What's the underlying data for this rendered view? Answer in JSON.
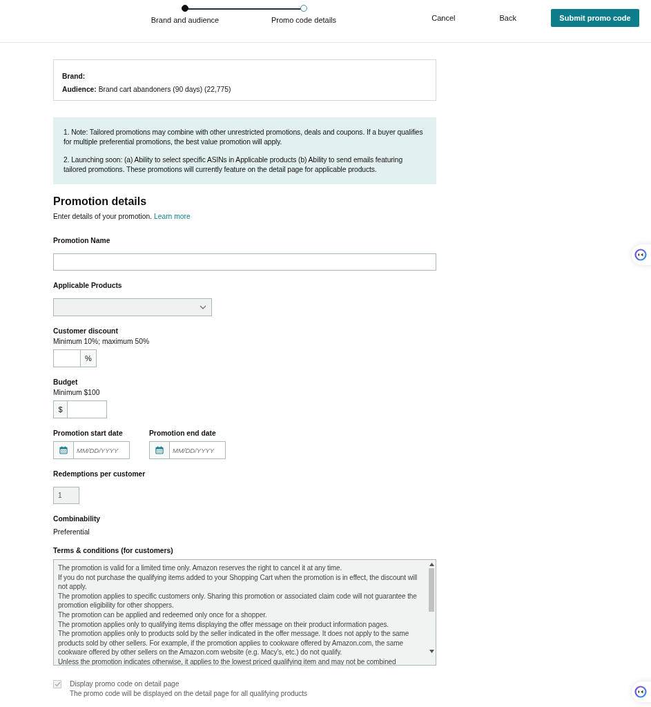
{
  "stepper": {
    "steps": [
      {
        "label": "Brand and audience",
        "completed": true
      },
      {
        "label": "Promo code details",
        "completed": false
      }
    ]
  },
  "actions": [
    {
      "label": "Cancel",
      "kind": "link"
    },
    {
      "label": "Back",
      "kind": "link"
    },
    {
      "label": "Submit promo code",
      "kind": "primary"
    }
  ],
  "summary": {
    "brand_label": "Brand:",
    "audience_label": "Audience:",
    "audience": "Brand cart abandoners (90 days) (22,775)"
  },
  "notes": [
    "1. Note: Tailored promotions may combine with other unrestricted promotions, deals and coupons. If a buyer qualifies for multiple preferential promotions, the best value promotion will apply.",
    "2. Launching soon: (a) Ability to select specific ASINs in Applicable products (b) Ability to send emails featuring tailored promotions. These promotions will currently feature on the detail page for applicable products."
  ],
  "section": {
    "title": "Promotion details",
    "subtitle": "Enter details of your promotion.",
    "link": "Learn more"
  },
  "fields": [
    {
      "kind": "text",
      "label": "Promotion Name"
    },
    {
      "kind": "select",
      "label": "Applicable Products"
    },
    {
      "kind": "percent",
      "label": "Customer discount",
      "hint": "Minimum 10%; maximum 50%",
      "addon": "%"
    },
    {
      "kind": "currency",
      "label": "Budget",
      "hint": "Minimum $100",
      "addon": "$"
    },
    {
      "kind": "dates",
      "items": [
        {
          "label": "Promotion start date",
          "placeholder": "MM/DD/YYYY"
        },
        {
          "label": "Promotion end date",
          "placeholder": "MM/DD/YYYY"
        }
      ]
    },
    {
      "kind": "readonly",
      "label": "Redemptions per customer",
      "value": "1"
    },
    {
      "kind": "static",
      "label": "Combinability",
      "value": "Preferential"
    },
    {
      "kind": "textarea",
      "label": "Terms & conditions (for customers)",
      "lines": [
        "The promotion is valid for a limited time only. Amazon reserves the right to cancel it at any time.",
        "If you do not purchase the qualifying items added to your Shopping Cart when the promotion is in effect, the discount will not apply.",
        "The promotion applies to specific customers only. Sharing this promotion or associated claim code will not guarantee the promotion eligibility for other shoppers.",
        "The promotion can be applied and redeemed only once for a shopper.",
        "The promotion applies only to qualifying items displaying the offer message on their product information pages.",
        "The promotion applies only to products sold by the seller indicated in the offer message. It does not apply to the same products sold by other sellers. For example, if the promotion applies to cookware offered by Amazon.com, the same cookware offered by other sellers on the Amazon.com website (e.g. Macy’s, etc.) do not qualify.",
        "Unless the promotion indicates otherwise, it applies to the lowest priced qualifying item and may not be combined"
      ]
    }
  ],
  "display_option": {
    "label": "Display promo code on detail page",
    "hint": "The promo code will be displayed on the detail page for all qualifying products",
    "checked": true,
    "disabled": true
  }
}
